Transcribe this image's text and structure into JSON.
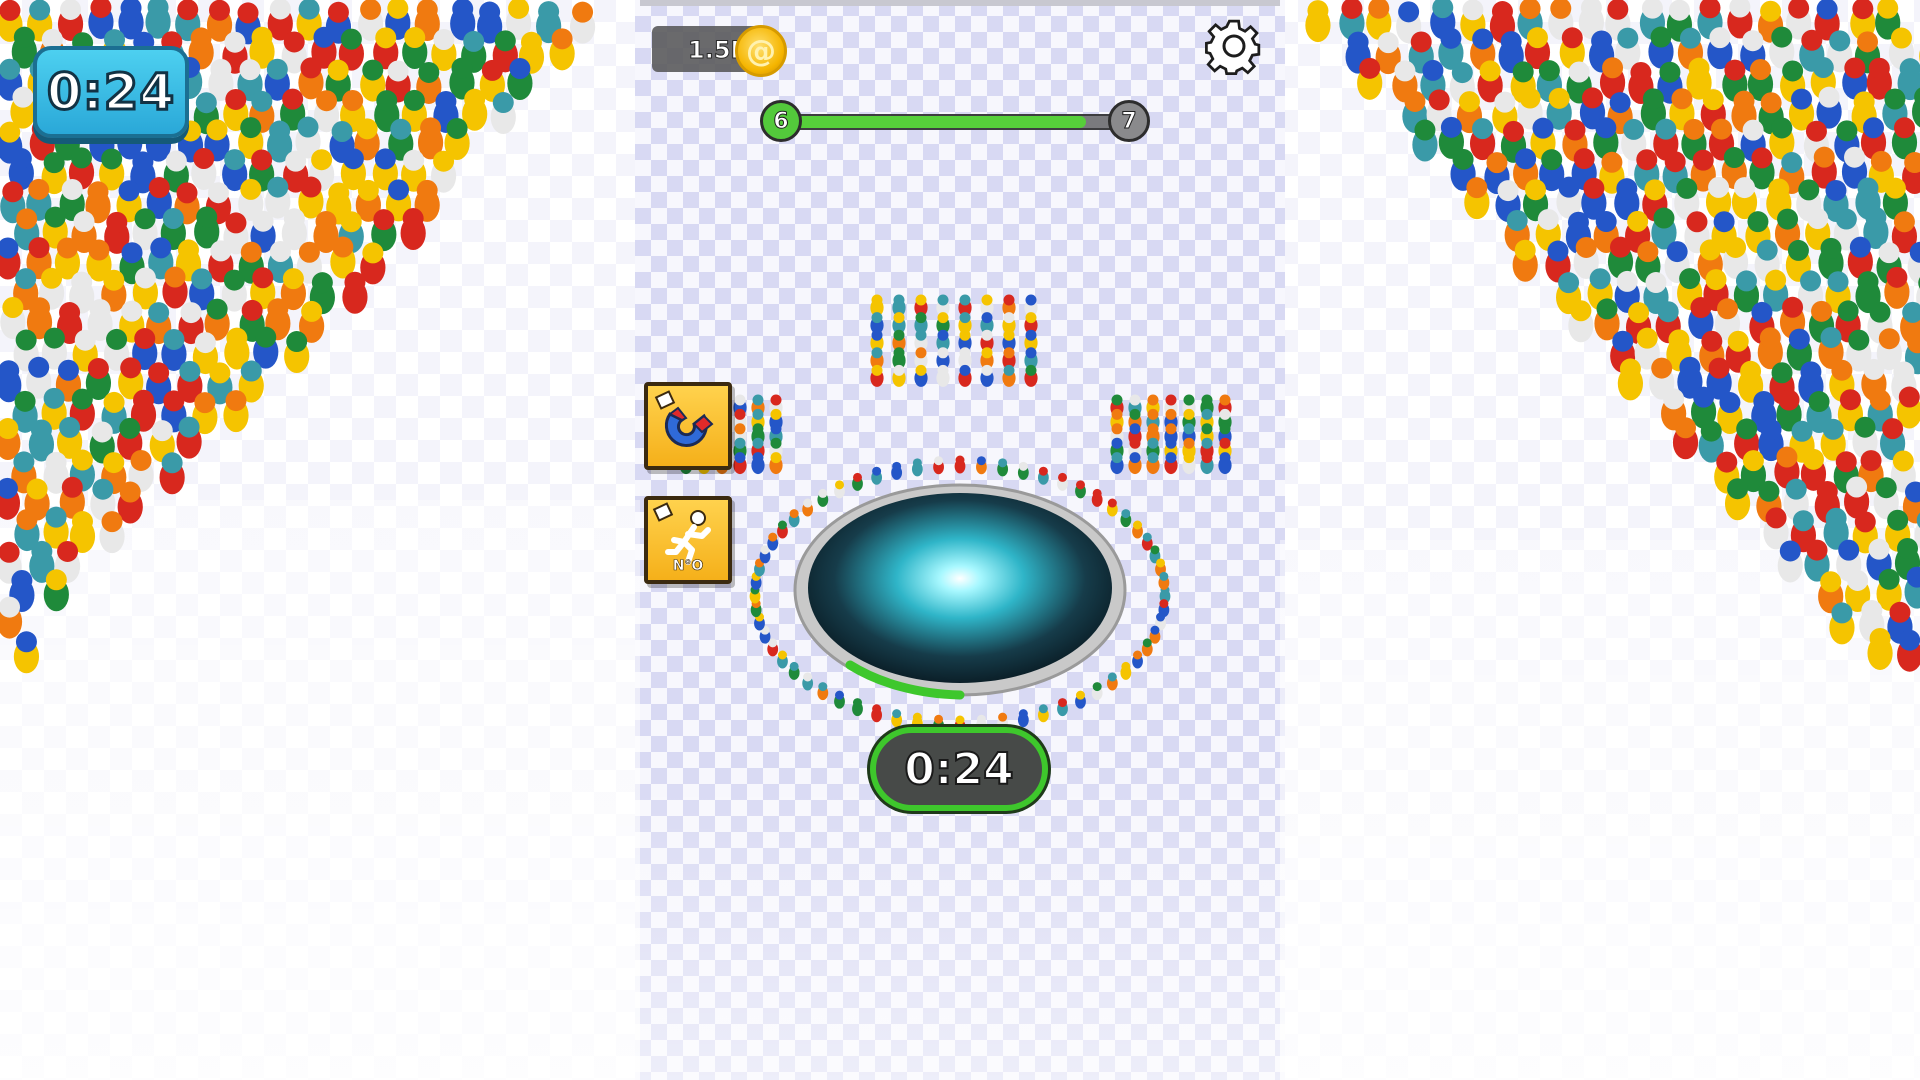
{
  "hud": {
    "timer": "0:24",
    "coins": "1.5K",
    "coin_symbol": "@",
    "settings_icon": "gear-icon",
    "level": {
      "current": "6",
      "next": "7",
      "progress": 0.88,
      "fill_color": "#56cf3a"
    }
  },
  "powerups": [
    {
      "icon": "magnet-icon"
    },
    {
      "icon": "running-man-icon",
      "label": "N°O"
    }
  ],
  "hole": {
    "timer": "0:24",
    "ring_color": "#3ec72c",
    "core_color": "#1f3b47",
    "glow_color": "#8ff2ff"
  },
  "scene": {
    "track_check_color": "#d8d9f3",
    "crowd_colors": [
      "#f5c400",
      "#d8281e",
      "#1f8a3a",
      "#2456c8",
      "#f07a10",
      "#e8e8e8",
      "#3a9aa8"
    ]
  }
}
